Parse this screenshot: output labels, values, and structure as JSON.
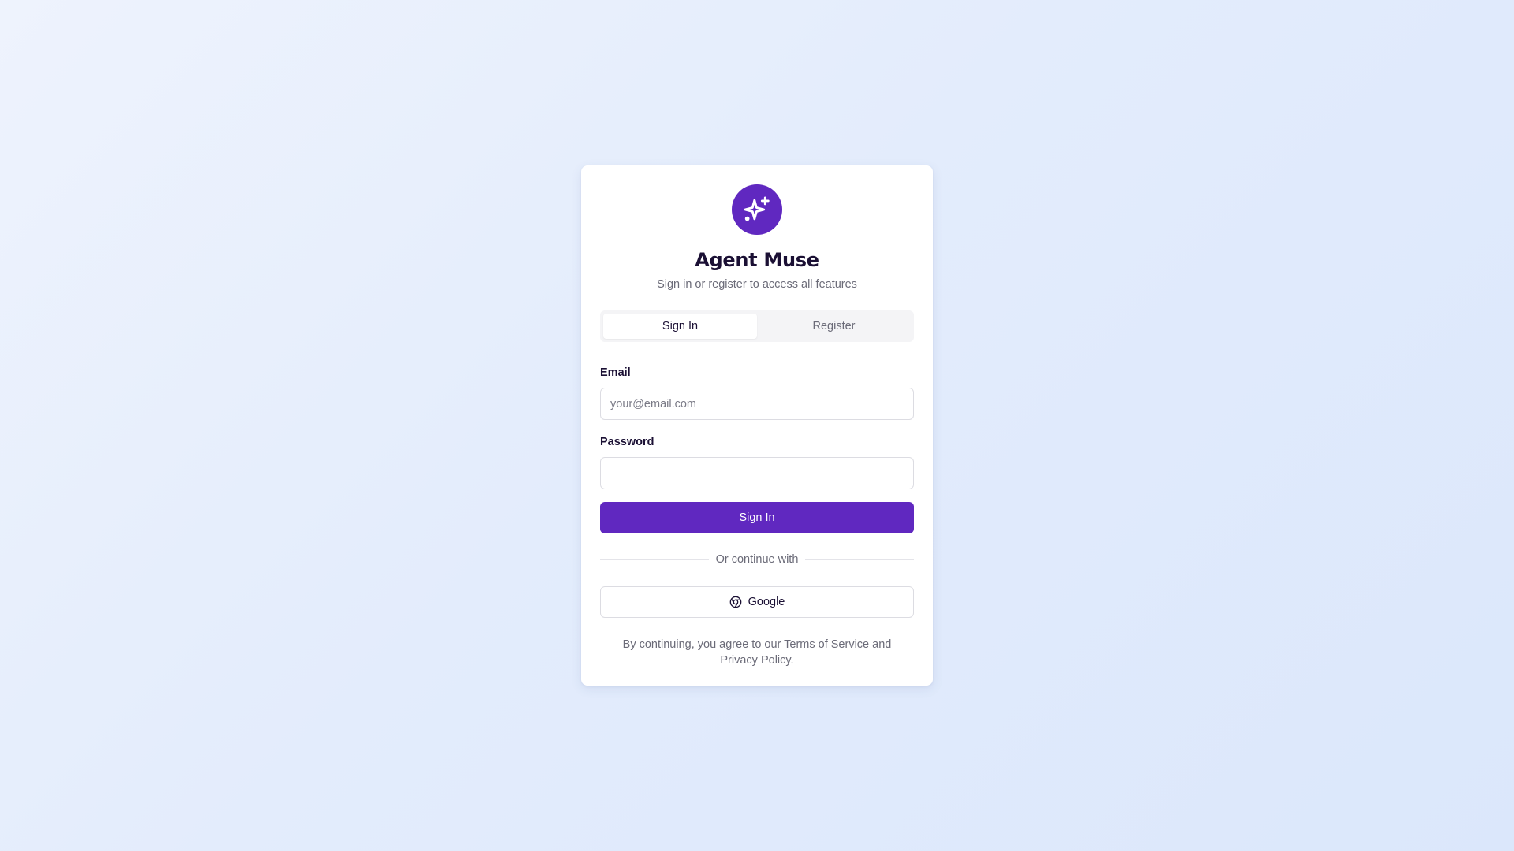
{
  "app": {
    "title": "Agent Muse",
    "subtitle": "Sign in or register to access all features",
    "logo_icon": "sparkles-icon"
  },
  "tabs": {
    "items": [
      {
        "label": "Sign In",
        "active": true
      },
      {
        "label": "Register",
        "active": false
      }
    ]
  },
  "form": {
    "email_label": "Email",
    "email_placeholder": "your@email.com",
    "email_value": "",
    "password_label": "Password",
    "password_value": "",
    "submit_label": "Sign In"
  },
  "divider": {
    "text": "Or continue with"
  },
  "social": {
    "google_label": "Google",
    "google_icon": "chrome-icon"
  },
  "terms": {
    "text": "By continuing, you agree to our Terms of Service and Privacy Policy."
  },
  "colors": {
    "accent": "#6028c0",
    "title": "#1b1034",
    "muted": "#6b6b78"
  }
}
